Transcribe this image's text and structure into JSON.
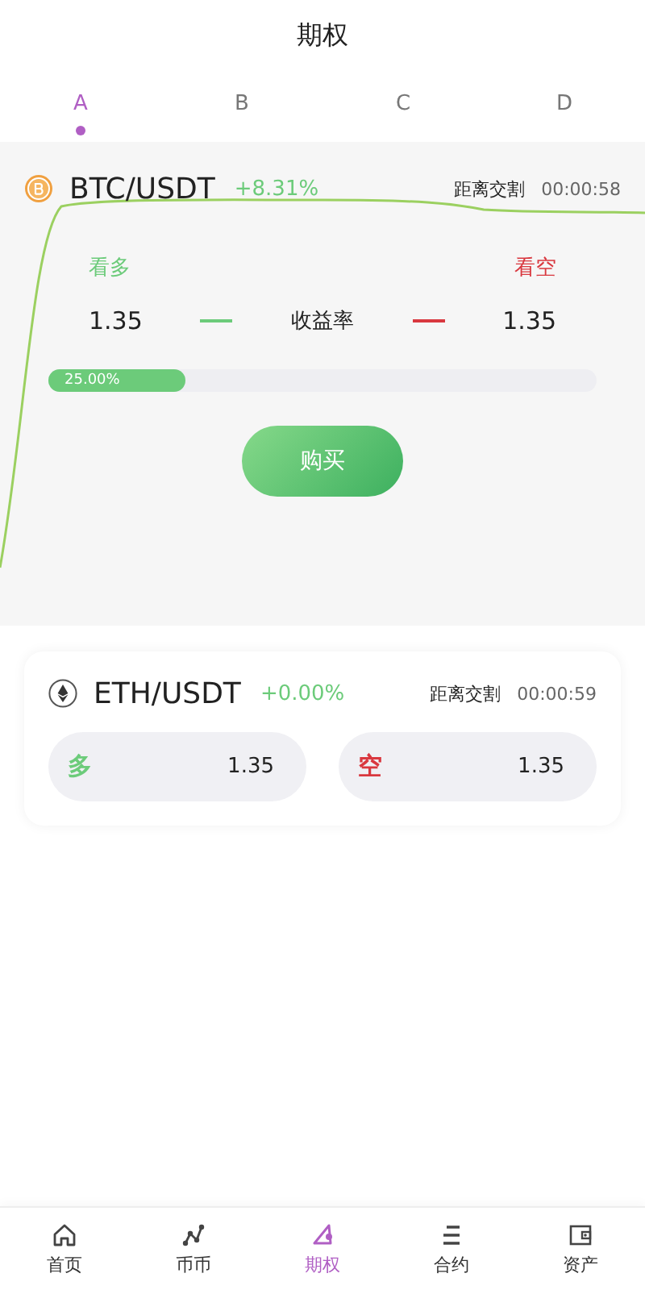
{
  "title": "期权",
  "tabs": [
    {
      "label": "A",
      "selected": true
    },
    {
      "label": "B",
      "selected": false
    },
    {
      "label": "C",
      "selected": false
    },
    {
      "label": "D",
      "selected": false
    }
  ],
  "active": {
    "kind": "btc",
    "pair": "BTC/USDT",
    "change": "+8.31%",
    "countdown_label": "距离交割",
    "countdown": "00:00:58",
    "long_label": "看多",
    "short_label": "看空",
    "long_value": "1.35",
    "rate_label": "收益率",
    "short_value": "1.35",
    "level": 0.25,
    "progress_label": "25.00%",
    "buy_button": "购买"
  },
  "markets": [
    {
      "kind": "eth",
      "pair": "ETH/USDT",
      "change": "+0.00%",
      "countdown_label": "距离交割",
      "countdown": "00:00:59",
      "long_label": "多",
      "long_value": "1.35",
      "short_label": "空",
      "short_value": "1.35"
    }
  ],
  "nav": [
    {
      "kind": "home",
      "label": "首页",
      "selected": false
    },
    {
      "kind": "nodes",
      "label": "币币",
      "selected": false
    },
    {
      "kind": "triangle",
      "label": "期权",
      "selected": true
    },
    {
      "kind": "lines",
      "label": "合约",
      "selected": false
    },
    {
      "kind": "wallet",
      "label": "资产",
      "selected": false
    }
  ]
}
